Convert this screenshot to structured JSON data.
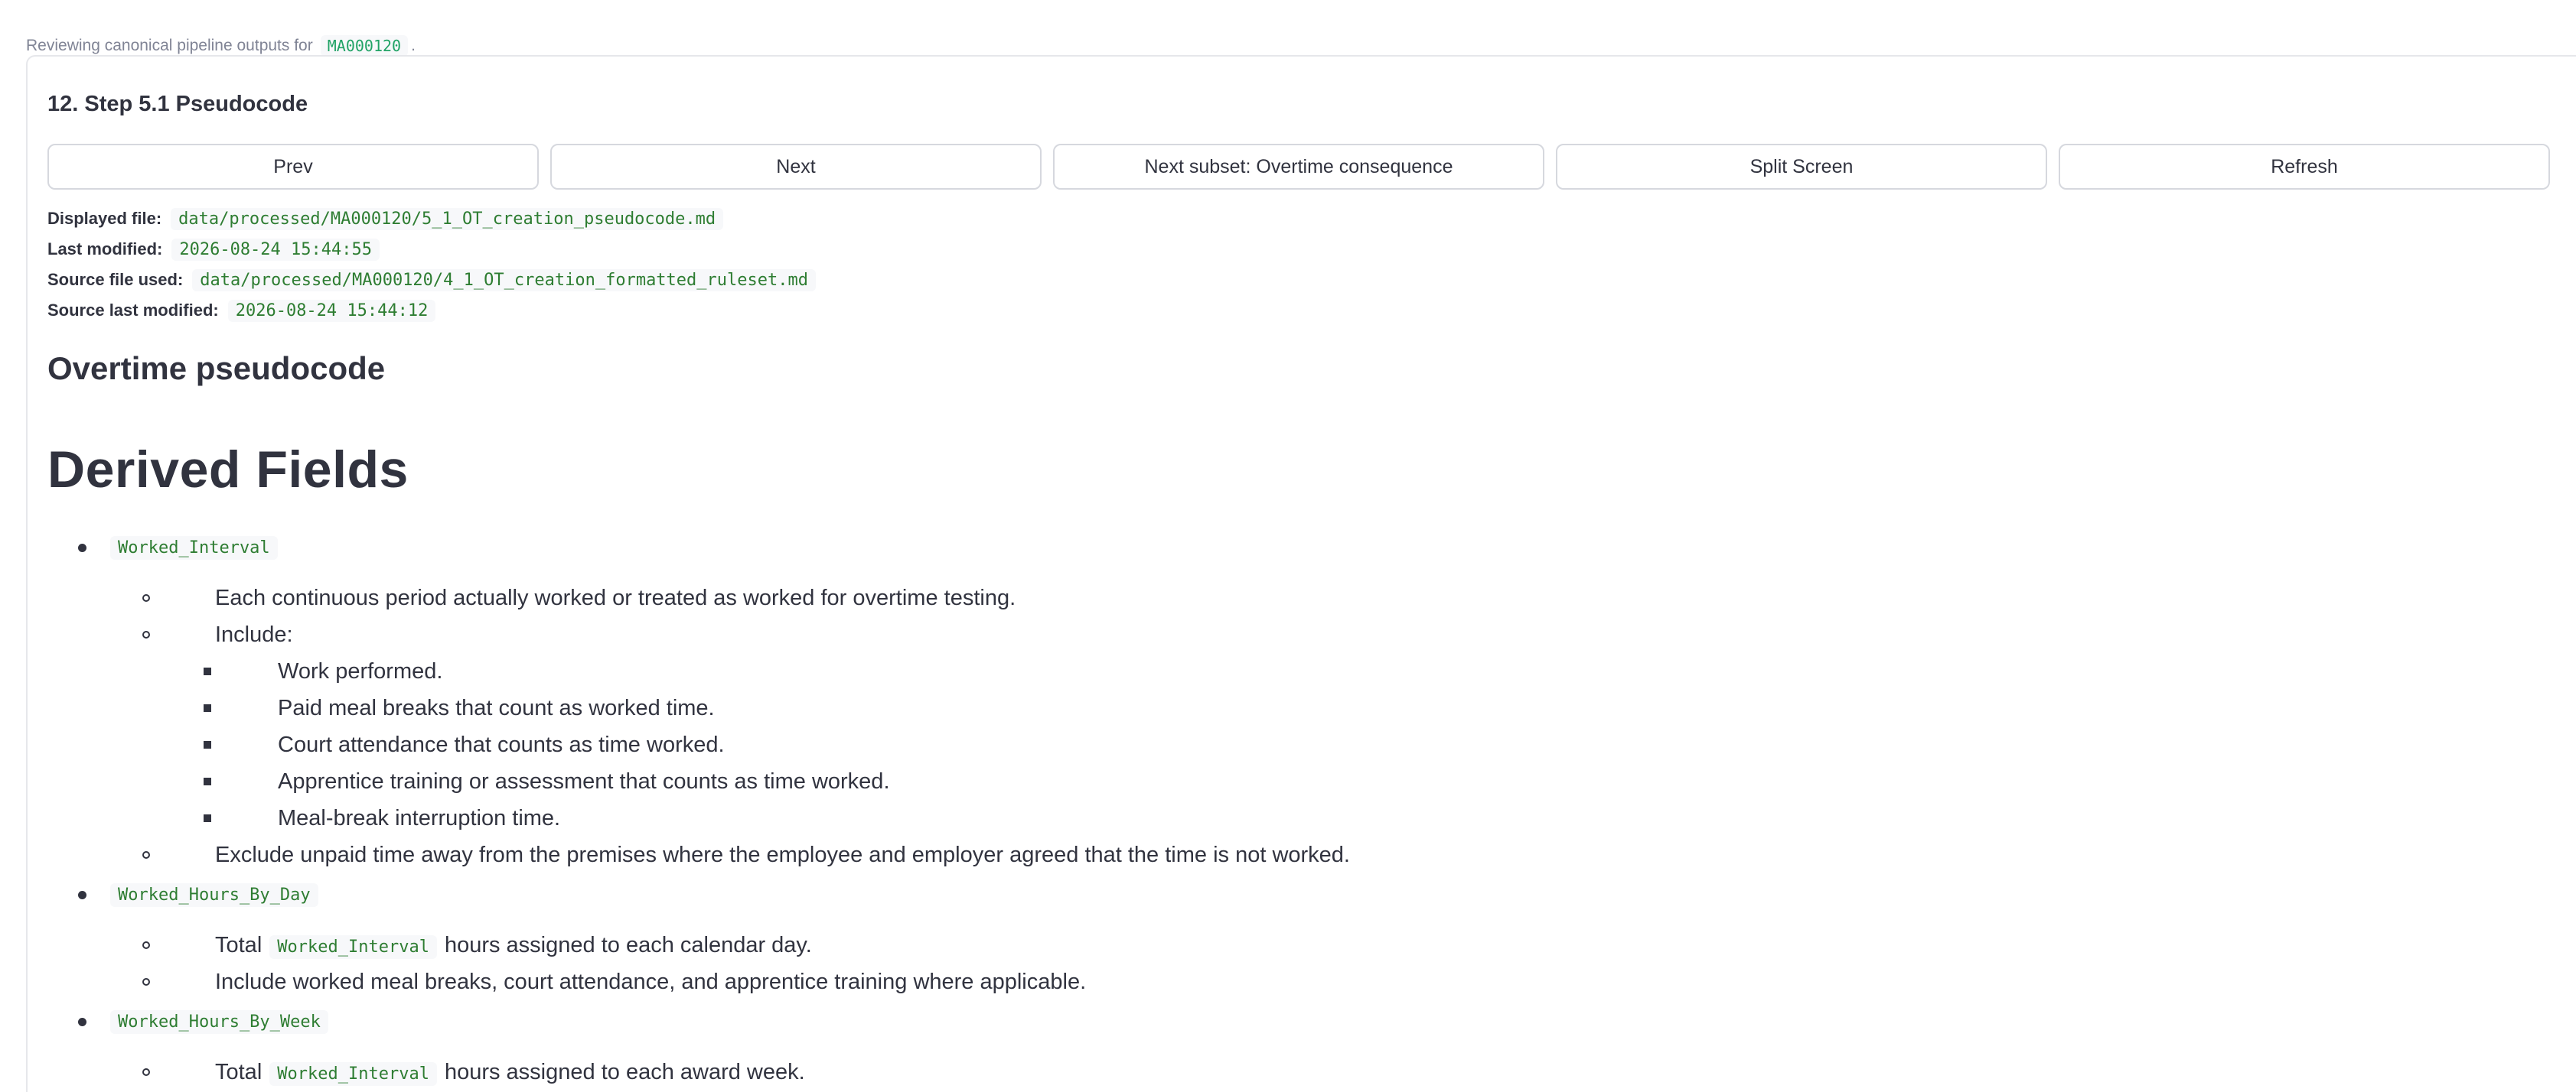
{
  "caption": {
    "prefix": "Reviewing canonical pipeline outputs for",
    "code": "MA000120",
    "suffix": "."
  },
  "section_title": "12. Step 5.1 Pseudocode",
  "buttons": {
    "prev": "Prev",
    "next": "Next",
    "next_subset": "Next subset: Overtime consequence",
    "split": "Split Screen",
    "refresh": "Refresh"
  },
  "meta": {
    "displayed_label": "Displayed file:",
    "displayed_value": "data/processed/MA000120/5_1_OT_creation_pseudocode.md",
    "modified_label": "Last modified:",
    "modified_value": "2026-08-24 15:44:55",
    "source_label": "Source file used:",
    "source_value": "data/processed/MA000120/4_1_OT_creation_formatted_ruleset.md",
    "source_modified_label": "Source last modified:",
    "source_modified_value": "2026-08-24 15:44:12"
  },
  "doc": {
    "h3": "Overtime pseudocode",
    "h1": "Derived Fields",
    "fields": {
      "worked_interval": {
        "name": "Worked_Interval",
        "desc": "Each continuous period actually worked or treated as worked for overtime testing.",
        "include_label": "Include:",
        "includes": [
          "Work performed.",
          "Paid meal breaks that count as worked time.",
          "Court attendance that counts as time worked.",
          "Apprentice training or assessment that counts as time worked.",
          "Meal-break interruption time."
        ],
        "exclude": "Exclude unpaid time away from the premises where the employee and employer agreed that the time is not worked."
      },
      "by_day": {
        "name": "Worked_Hours_By_Day",
        "total_prefix": "Total",
        "total_code": "Worked_Interval",
        "total_suffix": "hours assigned to each calendar day.",
        "include": "Include worked meal breaks, court attendance, and apprentice training where applicable."
      },
      "by_week": {
        "name": "Worked_Hours_By_Week",
        "total_prefix": "Total",
        "total_code": "Worked_Interval",
        "total_suffix": "hours assigned to each award week."
      }
    }
  }
}
